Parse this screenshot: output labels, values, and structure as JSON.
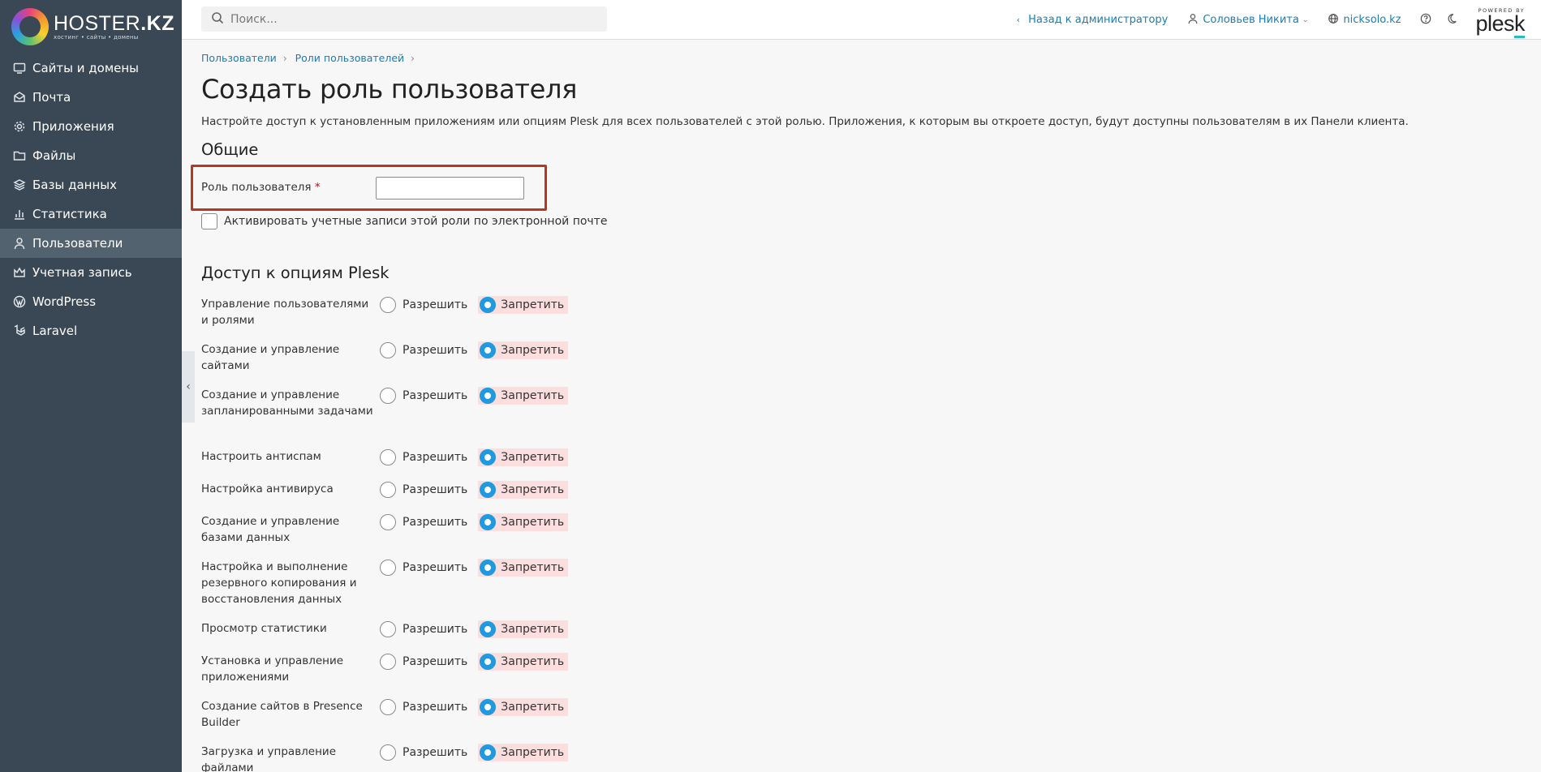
{
  "brand": {
    "name_light": "HOSTER",
    "name_bold": ".KZ",
    "tagline": "хостинг • сайты • домены"
  },
  "sidebar": {
    "items": [
      {
        "label": "Сайты и домены",
        "icon": "monitor-icon",
        "active": false
      },
      {
        "label": "Почта",
        "icon": "mail-icon",
        "active": false
      },
      {
        "label": "Приложения",
        "icon": "gear-icon",
        "active": false
      },
      {
        "label": "Файлы",
        "icon": "folder-icon",
        "active": false
      },
      {
        "label": "Базы данных",
        "icon": "layers-icon",
        "active": false
      },
      {
        "label": "Статистика",
        "icon": "bar-chart-icon",
        "active": false
      },
      {
        "label": "Пользователи",
        "icon": "user-icon",
        "active": true
      },
      {
        "label": "Учетная запись",
        "icon": "crown-icon",
        "active": false
      },
      {
        "label": "WordPress",
        "icon": "wordpress-icon",
        "active": false
      },
      {
        "label": "Laravel",
        "icon": "laravel-icon",
        "active": false
      }
    ]
  },
  "header": {
    "search_placeholder": "Поиск...",
    "back_label": "Назад к администратору",
    "user_name": "Соловьев Никита",
    "domain": "nicksolo.kz",
    "powered_by": "POWERED BY",
    "plesk_logo": "plesk"
  },
  "breadcrumb": {
    "item1": "Пользователи",
    "item2": "Роли пользователей"
  },
  "page": {
    "title": "Создать роль пользователя",
    "description": "Настройте доступ к установленным приложениям или опциям Plesk для всех пользователей с этой ролью. Приложения, к которым вы откроете доступ, будут доступны пользователям в их Панели клиента."
  },
  "general": {
    "title": "Общие",
    "role_label": "Роль пользователя",
    "required_mark": "*",
    "role_value": "",
    "activate_label": "Активировать учетные записи этой роли по электронной почте"
  },
  "access": {
    "title": "Доступ к опциям Plesk",
    "allow_label": "Разрешить",
    "deny_label": "Запретить",
    "options": [
      {
        "label": "Управление пользователями и ролями",
        "value": "deny"
      },
      {
        "label": "Создание и управление сайтами",
        "value": "deny"
      },
      {
        "label": "Создание и управление запланированными задачами",
        "value": "deny"
      },
      {
        "label": "Настроить антиспам",
        "value": "deny"
      },
      {
        "label": "Настройка антивируса",
        "value": "deny"
      },
      {
        "label": "Создание и управление базами данных",
        "value": "deny"
      },
      {
        "label": "Настройка и выполнение резервного копирования и восстановления данных",
        "value": "deny"
      },
      {
        "label": "Просмотр статистики",
        "value": "deny"
      },
      {
        "label": "Установка и управление приложениями",
        "value": "deny"
      },
      {
        "label": "Создание сайтов в Presence Builder",
        "value": "deny"
      },
      {
        "label": "Загрузка и управление файлами",
        "value": "deny"
      }
    ]
  },
  "colors": {
    "sidebar_bg": "#3a4856",
    "sidebar_active": "#53626f",
    "link": "#1a7db5",
    "radio_on": "#1f9ae0",
    "deny_bg": "#fcdede",
    "highlight": "#b8381f"
  }
}
